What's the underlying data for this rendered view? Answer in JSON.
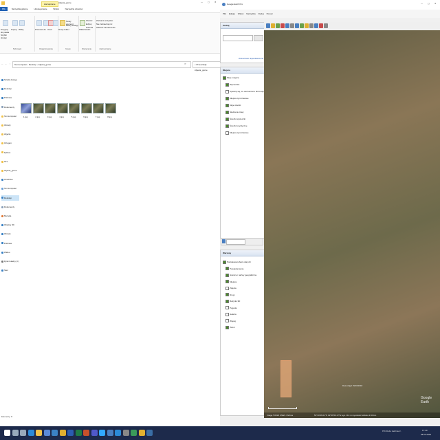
{
  "explorer": {
    "window_title": "zdjecia_gorne",
    "tabs": [
      "Plik",
      "Narzędzia główne",
      "Udostępnianie",
      "Widok",
      "Narzędzia obrazów"
    ],
    "active_tab_label": "Zarządzanie",
    "ribbon_groups": [
      "Schowek",
      "Organizowanie",
      "Nowy",
      "Otwieranie",
      "Zaznaczanie"
    ],
    "ribbon_buttons": {
      "pin": "Przypnij do paska Szybki dostęp",
      "copy": "Kopiuj",
      "paste": "Wklej",
      "new_item": "Nowy element",
      "easy_access": "Łatwy dostęp",
      "properties": "Właściwości",
      "open": "Otwórz",
      "edit": "Edytuj",
      "history": "Historia",
      "select_all": "Zaznacz wszystko",
      "select_none": "Nie zaznaczaj nic",
      "invert": "Odwróć zaznaczenie",
      "new_folder": "Nowy folder",
      "move": "Przenieś do",
      "copyto": "Kopiuj do",
      "delete": "Usuń",
      "rename": "Zmień nazwę"
    },
    "address": [
      "Ten komputer",
      "Desktop",
      "zdjecia_gorne"
    ],
    "search_placeholder": "Przeszukaj: zdjecia_gorne",
    "nav_items": [
      {
        "label": "Szybki dostęp",
        "color": "#3b82c4"
      },
      {
        "label": "Desktop",
        "color": "#3b82c4"
      },
      {
        "label": "Pobrane",
        "color": "#3b82c4"
      },
      {
        "label": "Dokumenty",
        "color": "#8aa0b8"
      },
      {
        "label": "Ten komputer",
        "color": "#f0c24a"
      },
      {
        "label": "Obrazy",
        "color": "#f0c24a"
      },
      {
        "label": "zdjęcia",
        "color": "#f0c24a"
      },
      {
        "label": "Ortogon",
        "color": "#f0c24a"
      },
      {
        "label": "Python",
        "color": "#f0c24a"
      },
      {
        "label": "STL",
        "color": "#f0c24a"
      },
      {
        "label": "zdjecia_gorne",
        "color": "#f0c24a"
      },
      {
        "label": "OneDrive",
        "color": "#3b82c4"
      },
      {
        "label": "Ten komputer",
        "color": "#6aa0d8"
      },
      {
        "label": "Desktop",
        "color": "#3b82c4",
        "selected": true
      },
      {
        "label": "Dokumenty",
        "color": "#8aa0b8"
      },
      {
        "label": "Muzyka",
        "color": "#e07b39"
      },
      {
        "label": "Obiekty 3D",
        "color": "#3b82c4"
      },
      {
        "label": "Obrazy",
        "color": "#3b82c4"
      },
      {
        "label": "Pobrane",
        "color": "#3b82c4"
      },
      {
        "label": "Wideo",
        "color": "#3b82c4"
      },
      {
        "label": "Dysk lokalny (C:)",
        "color": "#777777"
      },
      {
        "label": "Sieć",
        "color": "#3b82c4"
      }
    ],
    "files": [
      "1.jpg",
      "2.jpg",
      "3.jpg",
      "4.jpg",
      "5.jpg",
      "6.jpg",
      "7.jpg",
      "8.jpg"
    ],
    "status": "Elementy: 8"
  },
  "earth": {
    "window_title": "Google Earth Pro",
    "menu": [
      "Plik",
      "Edycja",
      "Widok",
      "Narzędzia",
      "Dodaj",
      "Pomoc"
    ],
    "search_panel_title": "Szukaj",
    "search_links": [
      "Wskazówki dojazdu",
      "Historia"
    ],
    "places_panel_title": "Miejsca",
    "places_items": [
      {
        "label": "Moje miejsca",
        "checked": true
      },
      {
        "label": "Wycieczka",
        "checked": true
      },
      {
        "label": "Upewnij się, że zaznaczono 3D budynki",
        "checked": false
      },
      {
        "label": "Miejsca tymczasowe",
        "checked": true
      },
      {
        "label": "Moje ścieżki",
        "checked": true
      },
      {
        "label": "Śledzenie trasy",
        "checked": true
      },
      {
        "label": "Ścieżki wycieczki",
        "checked": true
      },
      {
        "label": "Ścieżki turystyczne",
        "checked": true
      },
      {
        "label": "Miejsca tymczasowe",
        "checked": false
      }
    ],
    "layers_panel_title": "Warstwy",
    "layers_items": [
      {
        "label": "Podstawowa baza danych",
        "checked": true
      },
      {
        "label": "Powiadomienia",
        "checked": true
      },
      {
        "label": "Granice i nazwy geograficzne",
        "checked": true
      },
      {
        "label": "Miejsca",
        "checked": true
      },
      {
        "label": "Zdjęcia",
        "checked": false
      },
      {
        "label": "Drogi",
        "checked": true
      },
      {
        "label": "Budynki 3D",
        "checked": true
      },
      {
        "label": "Pogoda",
        "checked": false
      },
      {
        "label": "Galeria",
        "checked": false
      },
      {
        "label": "Więcej",
        "checked": false
      },
      {
        "label": "Teren",
        "checked": true
      }
    ],
    "watermark": "Google Earth",
    "image_date": "Data zdjęć: 8/23/2018",
    "coords": "53°20'46.01\"N  19°06'50.17\"E  wys. 114 m  wysokość widoku 2.60 km",
    "scale": "Image ©2023 CNES / Airbus"
  },
  "taskbar": {
    "time": "17:40",
    "date": "28.02.2023",
    "weather": "9°C Dużo zachmurz.",
    "apps": [
      "start",
      "search",
      "task-view",
      "edge",
      "explorer",
      "store",
      "mail",
      "chrome",
      "word",
      "excel",
      "powerpoint",
      "teams",
      "photoshop",
      "earth",
      "vscode",
      "camera",
      "maps",
      "notes",
      "python"
    ]
  }
}
